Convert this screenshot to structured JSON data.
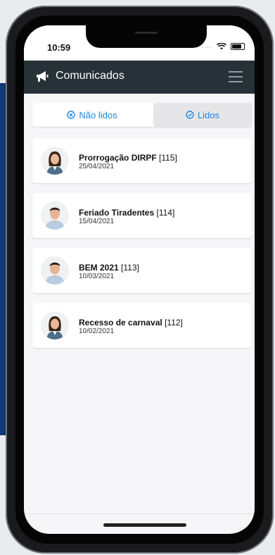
{
  "status_bar": {
    "time": "10:59",
    "signal_dots": "....",
    "icons": [
      "wifi-icon",
      "battery-icon"
    ]
  },
  "header": {
    "title": "Comunicados",
    "left_icon": "megaphone-icon",
    "right_icon": "menu-icon"
  },
  "tabs": [
    {
      "label": "Não lidos",
      "icon": "x-circle-icon",
      "selected": false
    },
    {
      "label": "Lidos",
      "icon": "check-circle-icon",
      "selected": true
    }
  ],
  "messages": [
    {
      "title": "Prorrogação DIRPF",
      "number": "[115]",
      "date": "25/04/2021",
      "avatar": "woman-avatar"
    },
    {
      "title": "Feriado Tiradentes",
      "number": "[114]",
      "date": "15/04/2021",
      "avatar": "man-avatar"
    },
    {
      "title": "BEM 2021",
      "number": "[113]",
      "date": "10/03/2021",
      "avatar": "man-avatar"
    },
    {
      "title": "Recesso de carnaval",
      "number": "[112]",
      "date": "10/02/2021",
      "avatar": "woman-avatar"
    }
  ],
  "colors": {
    "header_bg": "#263238",
    "accent": "#1e88e5",
    "side_band": "#0f3a74"
  }
}
